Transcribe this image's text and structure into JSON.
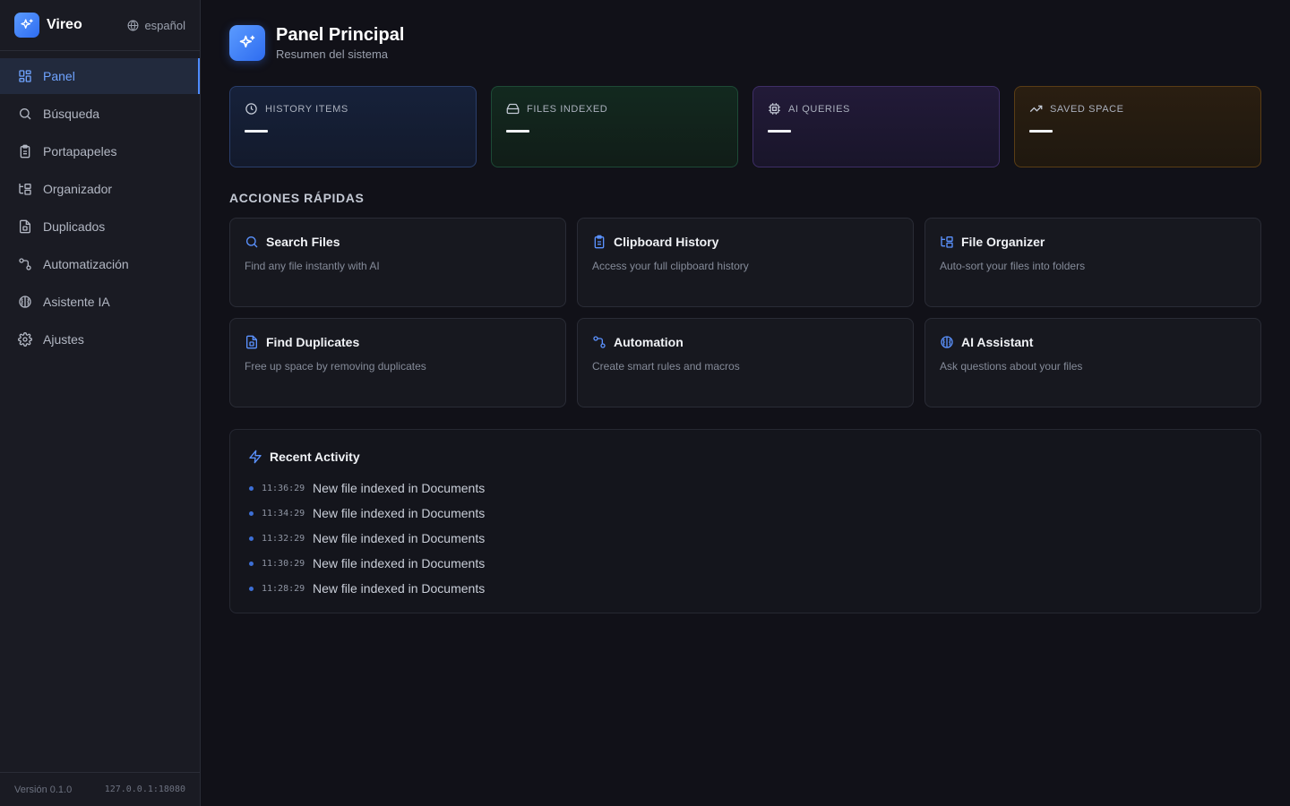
{
  "brand": {
    "name": "Vireo",
    "language": "español"
  },
  "sidebar": {
    "items": [
      {
        "label": "Panel",
        "icon": "dashboard-icon",
        "active": true
      },
      {
        "label": "Búsqueda",
        "icon": "search-icon"
      },
      {
        "label": "Portapapeles",
        "icon": "clipboard-icon"
      },
      {
        "label": "Organizador",
        "icon": "folder-tree-icon"
      },
      {
        "label": "Duplicados",
        "icon": "file-duplicate-icon"
      },
      {
        "label": "Automatización",
        "icon": "workflow-icon"
      },
      {
        "label": "Asistente IA",
        "icon": "brain-icon"
      },
      {
        "label": "Ajustes",
        "icon": "gear-icon"
      }
    ],
    "version": "Versión 0.1.0",
    "address": "127.0.0.1:18080"
  },
  "header": {
    "title": "Panel Principal",
    "subtitle": "Resumen del sistema"
  },
  "stats": [
    {
      "label": "HISTORY ITEMS",
      "icon": "clock-icon"
    },
    {
      "label": "FILES INDEXED",
      "icon": "drive-icon"
    },
    {
      "label": "AI QUERIES",
      "icon": "cpu-icon"
    },
    {
      "label": "SAVED SPACE",
      "icon": "trending-up-icon"
    }
  ],
  "quick_actions": {
    "title": "ACCIONES RÁPIDAS",
    "items": [
      {
        "title": "Search Files",
        "desc": "Find any file instantly with AI",
        "icon": "search-icon"
      },
      {
        "title": "Clipboard History",
        "desc": "Access your full clipboard history",
        "icon": "clipboard-icon"
      },
      {
        "title": "File Organizer",
        "desc": "Auto-sort your files into folders",
        "icon": "folder-tree-icon"
      },
      {
        "title": "Find Duplicates",
        "desc": "Free up space by removing duplicates",
        "icon": "file-duplicate-icon"
      },
      {
        "title": "Automation",
        "desc": "Create smart rules and macros",
        "icon": "workflow-icon"
      },
      {
        "title": "AI Assistant",
        "desc": "Ask questions about your files",
        "icon": "brain-icon"
      }
    ]
  },
  "activity": {
    "title": "Recent Activity",
    "items": [
      {
        "time": "11:36:29",
        "text": "New file indexed in Documents"
      },
      {
        "time": "11:34:29",
        "text": "New file indexed in Documents"
      },
      {
        "time": "11:32:29",
        "text": "New file indexed in Documents"
      },
      {
        "time": "11:30:29",
        "text": "New file indexed in Documents"
      },
      {
        "time": "11:28:29",
        "text": "New file indexed in Documents"
      }
    ]
  },
  "colors": {
    "accent": "#4d8bff",
    "background": "#111118",
    "sidebar": "#1a1b23"
  }
}
